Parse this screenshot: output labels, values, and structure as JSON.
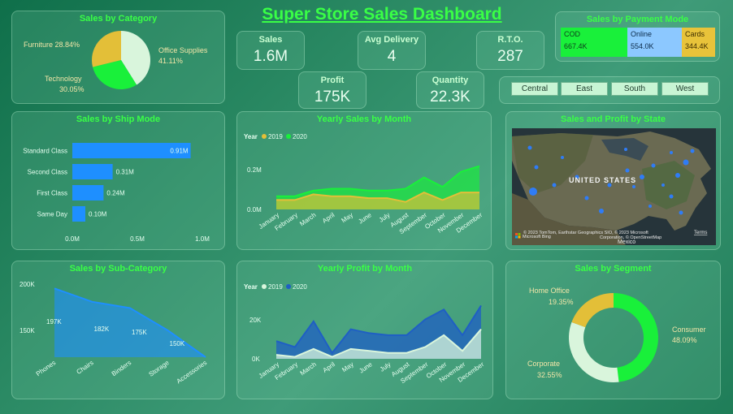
{
  "title": "Super Store Sales Dashboard",
  "kpis": {
    "sales": {
      "label": "Sales",
      "value": "1.6M"
    },
    "avg_delivery": {
      "label": "Avg Delivery",
      "value": "4"
    },
    "rto": {
      "label": "R.T.O.",
      "value": "287"
    },
    "profit": {
      "label": "Profit",
      "value": "175K"
    },
    "quantity": {
      "label": "Quantity",
      "value": "22.3K"
    }
  },
  "payment": {
    "title": "Sales by Payment Mode",
    "items": [
      {
        "name": "COD",
        "value": "667.4K",
        "color": "#19f03a"
      },
      {
        "name": "Online",
        "value": "554.0K",
        "color": "#8cc8ff"
      },
      {
        "name": "Cards",
        "value": "344.4K",
        "color": "#e8c33a"
      }
    ]
  },
  "regions": [
    "Central",
    "East",
    "South",
    "West"
  ],
  "category": {
    "title": "Sales by Category",
    "labels": {
      "furniture": "Furniture 28.84%",
      "office_name": "Office Supplies",
      "office_pct": "41.11%",
      "tech_name": "Technology",
      "tech_pct": "30.05%"
    }
  },
  "ship_mode": {
    "title": "Sales by Ship Mode",
    "ticks": [
      "0.0M",
      "0.5M",
      "1.0M"
    ]
  },
  "yearly_sales": {
    "title": "Yearly Sales by Month",
    "legend_label": "Year",
    "legend": [
      "2019",
      "2020"
    ],
    "yticks": [
      "0.2M",
      "0.0M"
    ]
  },
  "map": {
    "title": "Sales and Profit by State",
    "country_label": "UNITED STATES",
    "mexico_label": "Mexico",
    "attribution": "© 2023 TomTom, Earthstar Geographics SIO, © 2023 Microsoft",
    "attribution2": "Corporation, © OpenStreetMap",
    "terms": "Terms",
    "brand": "Microsoft Bing"
  },
  "sub_category": {
    "title": "Sales by Sub-Category",
    "yticks": [
      "200K",
      "150K"
    ]
  },
  "yearly_profit": {
    "title": "Yearly Profit by Month",
    "legend_label": "Year",
    "legend": [
      "2019",
      "2020"
    ],
    "yticks": [
      "20K",
      "0K"
    ]
  },
  "segment": {
    "title": "Sales by Segment",
    "labels": {
      "home_name": "Home Office",
      "home_pct": "19.35%",
      "consumer_name": "Consumer",
      "consumer_pct": "48.09%",
      "corp_name": "Corporate",
      "corp_pct": "32.55%"
    }
  },
  "chart_data": [
    {
      "type": "pie",
      "title": "Sales by Category",
      "categories": [
        "Office Supplies",
        "Technology",
        "Furniture"
      ],
      "values": [
        41.11,
        30.05,
        28.84
      ],
      "colors": [
        "#d9f5dc",
        "#19f03a",
        "#e3bf38"
      ]
    },
    {
      "type": "bar",
      "title": "Sales by Ship Mode",
      "categories": [
        "Standard Class",
        "Second Class",
        "First Class",
        "Same Day"
      ],
      "values": [
        0.91,
        0.31,
        0.24,
        0.1
      ],
      "value_labels": [
        "0.91M",
        "0.31M",
        "0.24M",
        "0.10M"
      ],
      "xlim": [
        0,
        1.0
      ],
      "color": "#1e8fff"
    },
    {
      "type": "area",
      "title": "Yearly Sales by Month",
      "categories": [
        "January",
        "February",
        "March",
        "April",
        "May",
        "June",
        "July",
        "August",
        "September",
        "October",
        "November",
        "December"
      ],
      "series": [
        {
          "name": "2019",
          "values": [
            0.05,
            0.05,
            0.08,
            0.07,
            0.07,
            0.06,
            0.06,
            0.04,
            0.09,
            0.05,
            0.09,
            0.09
          ],
          "color": "#e3bf38"
        },
        {
          "name": "2020",
          "values": [
            0.07,
            0.07,
            0.1,
            0.11,
            0.11,
            0.1,
            0.1,
            0.11,
            0.17,
            0.12,
            0.2,
            0.23
          ],
          "color": "#19f03a"
        }
      ],
      "ylim": [
        0,
        0.25
      ]
    },
    {
      "type": "area",
      "title": "Sales by Sub-Category",
      "categories": [
        "Phones",
        "Chairs",
        "Binders",
        "Storage",
        "Accessories"
      ],
      "values": [
        197,
        182,
        175,
        150,
        120
      ],
      "value_labels": [
        "197K",
        "182K",
        "175K",
        "150K",
        ""
      ],
      "ylim": [
        120,
        200
      ],
      "color": "#1e8fff"
    },
    {
      "type": "area",
      "title": "Yearly Profit by Month",
      "categories": [
        "January",
        "February",
        "March",
        "April",
        "May",
        "June",
        "July",
        "August",
        "September",
        "October",
        "November",
        "December"
      ],
      "series": [
        {
          "name": "2019",
          "values": [
            2,
            1,
            5,
            1,
            5,
            4,
            3,
            3,
            6,
            12,
            4,
            15
          ],
          "color": "#d9f5dc"
        },
        {
          "name": "2020",
          "values": [
            9,
            6,
            19,
            3,
            15,
            13,
            12,
            12,
            20,
            25,
            12,
            27
          ],
          "color": "#1f5fc4"
        }
      ],
      "ylim": [
        0,
        28
      ]
    },
    {
      "type": "pie",
      "title": "Sales by Segment",
      "categories": [
        "Consumer",
        "Corporate",
        "Home Office"
      ],
      "values": [
        48.09,
        32.55,
        19.35
      ],
      "colors": [
        "#19f03a",
        "#d9f5dc",
        "#e3bf38"
      ]
    }
  ]
}
